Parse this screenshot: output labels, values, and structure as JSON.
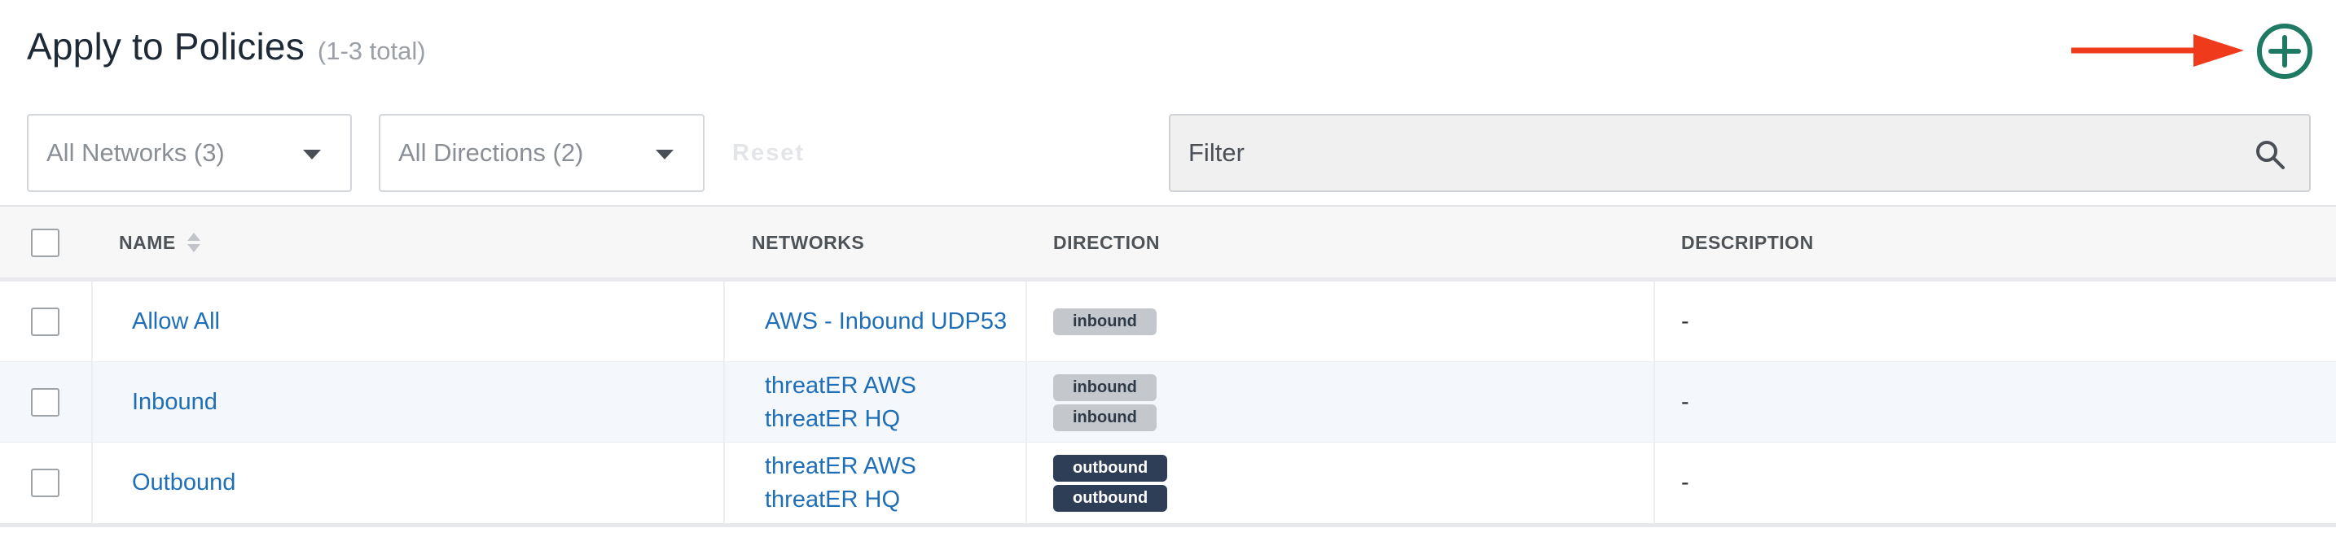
{
  "header": {
    "title": "Apply to Policies",
    "count": "(1-3 total)"
  },
  "toolbar": {
    "networks_filter": "All Networks (3)",
    "directions_filter": "All Directions (2)",
    "reset_label": "Reset",
    "filter_placeholder": "Filter"
  },
  "table": {
    "columns": [
      "NAME",
      "NETWORKS",
      "DIRECTION",
      "DESCRIPTION"
    ],
    "rows": [
      {
        "name": "Allow All",
        "networks": [
          "AWS - Inbound UDP53"
        ],
        "directions": [
          "inbound"
        ],
        "description": "-"
      },
      {
        "name": "Inbound",
        "networks": [
          "threatER AWS",
          "threatER HQ"
        ],
        "directions": [
          "inbound",
          "inbound"
        ],
        "description": "-"
      },
      {
        "name": "Outbound",
        "networks": [
          "threatER AWS",
          "threatER HQ"
        ],
        "directions": [
          "outbound",
          "outbound"
        ],
        "description": "-"
      }
    ]
  },
  "colors": {
    "accent_green": "#1f7a63",
    "annotation_arrow": "#f03a1c",
    "link_blue": "#1f6fb8",
    "inbound_badge": "#c4c7cc",
    "outbound_badge": "#2f3e57"
  },
  "icons": {
    "add": "plus-circle-icon",
    "search": "search-icon",
    "sort": "sort-icon",
    "caret": "chevron-down-icon"
  }
}
